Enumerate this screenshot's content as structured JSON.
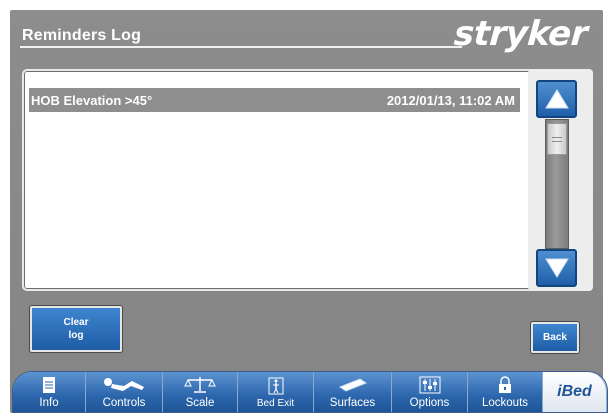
{
  "header": {
    "title": "Reminders Log",
    "brand": "stryker"
  },
  "log": {
    "entries": [
      {
        "name": "HOB Elevation >45°",
        "timestamp": "2012/01/13, 11:02 AM"
      }
    ]
  },
  "buttons": {
    "clear_log": "Clear log",
    "back": "Back"
  },
  "nav": {
    "tabs": [
      {
        "label": "Info",
        "icon": "document-icon"
      },
      {
        "label": "Controls",
        "icon": "patient-bed-icon"
      },
      {
        "label": "Scale",
        "icon": "balance-scale-icon"
      },
      {
        "label": "Bed Exit",
        "icon": "person-standing-icon"
      },
      {
        "label": "Surfaces",
        "icon": "mattress-icon"
      },
      {
        "label": "Options",
        "icon": "sliders-icon"
      },
      {
        "label": "Lockouts",
        "icon": "padlock-icon"
      }
    ],
    "brand_tab": "iBed"
  },
  "colors": {
    "accent_blue": "#2c66ac",
    "panel_gray": "#8d8d8d"
  }
}
